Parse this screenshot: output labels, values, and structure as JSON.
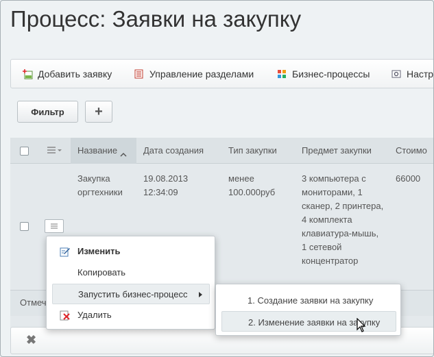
{
  "page": {
    "title": "Процесс: Заявки на закупку"
  },
  "toolbar": {
    "items": [
      {
        "label": "Добавить заявку",
        "icon": "add-document-icon"
      },
      {
        "label": "Управление разделами",
        "icon": "sections-list-icon"
      },
      {
        "label": "Бизнес-процессы",
        "icon": "business-process-icon"
      },
      {
        "label": "Настр",
        "icon": "settings-icon"
      }
    ]
  },
  "filter": {
    "filter_label": "Фильтр",
    "add_label": "+"
  },
  "grid": {
    "columns": [
      "Название",
      "Дата создания",
      "Тип закупки",
      "Предмет закупки",
      "Стоимо"
    ],
    "rows": [
      {
        "name_lines": [
          "Закупка",
          "оргтехники"
        ],
        "date_lines": [
          "19.08.2013",
          "12:34:09"
        ],
        "type_lines": [
          "менее",
          "100.000руб"
        ],
        "subject_lines": [
          "3 компьютера с",
          "мониторами, 1",
          "сканер, 2 принтера,",
          "4 комплекта",
          "клавиатура-мышь,",
          "1 сетевой",
          "концентратор"
        ],
        "cost": "66000"
      }
    ],
    "footer_text": "Отмеч"
  },
  "context_menu": {
    "items": [
      {
        "label": "Изменить",
        "icon": "edit-icon",
        "bold": true
      },
      {
        "label": "Копировать",
        "icon": ""
      },
      {
        "label": "Запустить бизнес-процесс",
        "icon": "",
        "has_submenu": true
      },
      {
        "label": "Удалить",
        "icon": "delete-icon"
      }
    ]
  },
  "submenu": {
    "items": [
      {
        "label": "1. Создание заявки на закупку"
      },
      {
        "label": "2. Изменение заявки на закупку"
      }
    ]
  },
  "bottom": {
    "close_label": "✖"
  },
  "colors": {
    "background": "#eef2f4",
    "grid_background": "#e4e9ec",
    "header_sorted": "#cfd7db"
  }
}
